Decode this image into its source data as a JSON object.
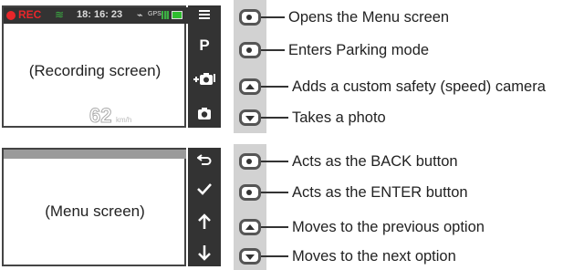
{
  "recording": {
    "status": {
      "rec_label": "REC",
      "time": "18: 16: 23",
      "gps_label": "GPS"
    },
    "screen_label": "(Recording screen)",
    "speed": "62",
    "speed_unit": "km/h",
    "side_icons": [
      "menu-icon",
      "parking-icon",
      "add-camera-icon",
      "camera-icon"
    ],
    "parking_glyph": "P",
    "buttons": [
      {
        "type": "dot",
        "label": "Opens the Menu screen"
      },
      {
        "type": "dot",
        "label": "Enters Parking mode"
      },
      {
        "type": "up",
        "label": "Adds a custom safety (speed) camera"
      },
      {
        "type": "down",
        "label": "Takes a photo"
      }
    ]
  },
  "menu": {
    "screen_label": "(Menu screen)",
    "side_icons": [
      "back-icon",
      "check-icon",
      "arrow-up-icon",
      "arrow-down-icon"
    ],
    "side_glyphs": [
      "↩",
      "✓",
      "↑",
      "↓"
    ],
    "buttons": [
      {
        "type": "dot",
        "label": "Acts as the BACK button"
      },
      {
        "type": "dot",
        "label": "Acts as the ENTER button"
      },
      {
        "type": "up",
        "label": "Moves to the previous option"
      },
      {
        "type": "down",
        "label": "Moves to the next option"
      }
    ]
  },
  "colors": {
    "rec_red": "#e8262a",
    "gps_green": "#3cb043",
    "battery_green": "#2ebd2e",
    "panel_dark": "#333333",
    "strip_gray": "#d2d2d2"
  }
}
